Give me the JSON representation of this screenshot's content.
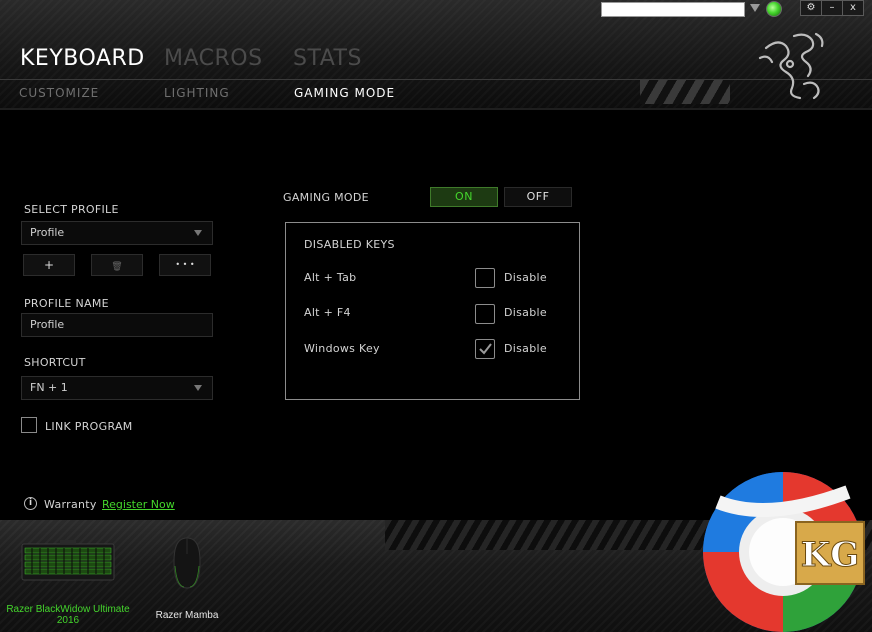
{
  "header": {
    "main_tabs": [
      {
        "label": "KEYBOARD",
        "active": true
      },
      {
        "label": "MACROS",
        "active": false
      },
      {
        "label": "STATS",
        "active": false
      }
    ],
    "sub_tabs": [
      {
        "label": "CUSTOMIZE",
        "active": false
      },
      {
        "label": "LIGHTING",
        "active": false
      },
      {
        "label": "GAMING MODE",
        "active": true
      }
    ],
    "window_buttons": {
      "settings": "⚙",
      "minimize": "–",
      "close": "x"
    }
  },
  "left_panel": {
    "select_profile_label": "SELECT PROFILE",
    "profile_dropdown_value": "Profile",
    "add_button": "+",
    "delete_button": "🗑",
    "more_button": "• • •",
    "profile_name_label": "PROFILE NAME",
    "profile_name_value": "Profile",
    "shortcut_label": "SHORTCUT",
    "shortcut_value": "FN + 1",
    "link_program_label": "LINK PROGRAM",
    "link_program_checked": false
  },
  "gaming_mode": {
    "label": "GAMING MODE",
    "on_label": "ON",
    "off_label": "OFF",
    "state": "on",
    "disabled_keys_title": "DISABLED KEYS",
    "keys": [
      {
        "name": "Alt + Tab",
        "action": "Disable",
        "checked": false
      },
      {
        "name": "Alt + F4",
        "action": "Disable",
        "checked": false
      },
      {
        "name": "Windows Key",
        "action": "Disable",
        "checked": true
      }
    ]
  },
  "warranty": {
    "label": "Warranty",
    "link": "Register Now"
  },
  "devices": [
    {
      "name_line1": "Razer BlackWidow Ultimate",
      "name_line2": "2016",
      "active": true
    },
    {
      "name_line1": "Razer Mamba",
      "name_line2": "",
      "active": false
    }
  ],
  "watermark": {
    "text": "KG"
  },
  "colors": {
    "accent_green": "#44d62c",
    "on_bg": "#1d3a12",
    "text_gray": "#cfcfcf"
  }
}
